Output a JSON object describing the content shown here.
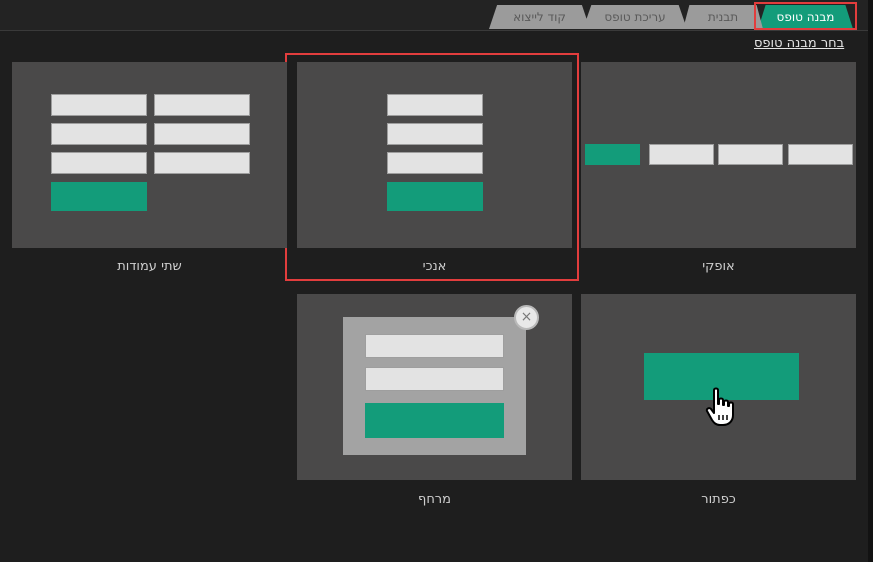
{
  "tabs": [
    {
      "label": "מבנה טופס",
      "active": true
    },
    {
      "label": "תבנית",
      "active": false
    },
    {
      "label": "עריכת טופס",
      "active": false
    },
    {
      "label": "קוד לייצוא",
      "active": false
    }
  ],
  "heading": "בחר מבנה טופס",
  "layouts": {
    "horizontal": "אופקי",
    "vertical": "אנכי",
    "two_columns": "שתי עמודות",
    "button": "כפתור",
    "floating": "מרחף"
  },
  "close_symbol": "×",
  "colors": {
    "accent": "#139c7a",
    "selection_border": "#e23d3d",
    "card_bg": "#4a4949",
    "page_bg": "#1e1e1e"
  },
  "icons": [
    "close-icon",
    "hand-pointer-icon"
  ]
}
